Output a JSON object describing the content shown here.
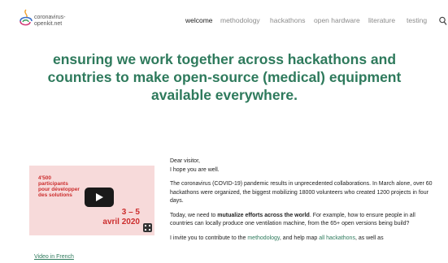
{
  "logo": {
    "line1": "coronavirus-",
    "line2": "openkit.net"
  },
  "nav": {
    "items": [
      {
        "label": "welcome",
        "active": true
      },
      {
        "label": "methodology",
        "active": false
      },
      {
        "label": "hackathons",
        "active": false
      },
      {
        "label": "open hardware",
        "active": false
      },
      {
        "label": "literature",
        "active": false
      },
      {
        "label": "testing",
        "active": false
      }
    ]
  },
  "headline": "ensuring we work together across hackathons and countries to make open-source (medical) equipment available everywhere.",
  "video": {
    "overlay_lines": [
      "4'500",
      "participants",
      "pour développer",
      "des solutions"
    ],
    "date_line1": "3 – 5",
    "date_line2": "avril 2020",
    "link_label": "Video in French"
  },
  "content": {
    "greeting": "Dear visitor,",
    "hope": "I hope you are well.",
    "para1": "The coronavirus (COVID-19) pandemic results in unprecedented collaborations. In March alone, over 60 hackathons were organized, the biggest mobilizing 18000 volunteers who created 1200 projects in four days.",
    "para2_pre": "Today, we need to ",
    "para2_bold": "mutualize efforts across the world",
    "para2_post": ". For example, how to ensure people in all countries can locally produce one ventilation machine, from the 65+ open versions being build?",
    "para3_pre": "I invite you to contribute to the ",
    "para3_link1": "methodology",
    "para3_mid": ", and help map ",
    "para3_link2": "all hackathons",
    "para3_post": ", as well as"
  },
  "colors": {
    "accent": "#2e7a5c",
    "video_bg": "#f7dada",
    "video_text": "#cc2e2e"
  },
  "icons": {
    "search": "search-icon",
    "play": "play-icon",
    "fullscreen": "fullscreen-icon"
  }
}
